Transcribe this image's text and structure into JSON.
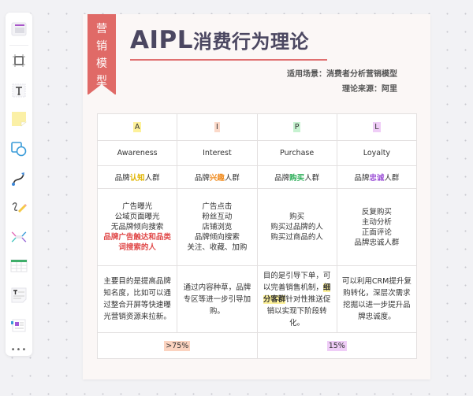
{
  "toolbar": {
    "items": [
      {
        "name": "frame-template-icon"
      },
      {
        "name": "crop-frame-icon"
      },
      {
        "name": "text-box-icon"
      },
      {
        "name": "sticky-note-icon"
      },
      {
        "name": "shapes-icon"
      },
      {
        "name": "connector-icon"
      },
      {
        "name": "pen-icon"
      },
      {
        "name": "mind-map-icon"
      },
      {
        "name": "table-icon"
      },
      {
        "name": "text-document-icon"
      },
      {
        "name": "template-cards-icon"
      },
      {
        "name": "more-icon"
      }
    ],
    "more_label": "•••"
  },
  "card": {
    "ribbon": [
      "营",
      "销",
      "模",
      "型"
    ],
    "title_en": "AIPL",
    "title_cn": "消费行为理论",
    "scenario": "适用场景：消费者分析营销模型",
    "source": "理论来源：阿里",
    "colors": {
      "ribbon": "#e06a67",
      "title": "#4b4761",
      "underline": "#e07070"
    }
  },
  "table": {
    "columns": [
      {
        "letter": "A",
        "letter_bg": "#fdf19a",
        "name": "Awareness",
        "group_pre": "品牌",
        "group_kw": "认知",
        "group_post": "人群",
        "kw_color": "#e0b400",
        "list": [
          "广告曝光",
          "公域页面曝光",
          "无品牌倾向搜索"
        ],
        "list_red": [
          "品牌广告触达和品类",
          "词搜索的人"
        ],
        "desc": "主要目的是提高品牌知名度，比如可以通过整合开屏等快速曝光营销资源来拉新。"
      },
      {
        "letter": "I",
        "letter_bg": "#fbd9c9",
        "name": "Interest",
        "group_pre": "品牌",
        "group_kw": "兴趣",
        "group_post": "人群",
        "kw_color": "#f08a1c",
        "list": [
          "广告点击",
          "粉丝互动",
          "店铺浏览",
          "品牌倾向搜索",
          "关注、收藏、加购"
        ],
        "list_red": [],
        "desc": "通过内容种草，品牌专区等进一步引导加购。"
      },
      {
        "letter": "P",
        "letter_bg": "#c6f2d0",
        "name": "Purchase",
        "group_pre": "品牌",
        "group_kw": "购买",
        "group_post": "人群",
        "kw_color": "#2fae5a",
        "list": [
          "购买",
          "购买过品牌的人",
          "购买过商品的人"
        ],
        "list_red": [],
        "desc_pre": "目的是引导下单，可以完善销售机制，",
        "desc_mark": "细分客群",
        "desc_post": "针对性推送促销以实现下阶段转化。"
      },
      {
        "letter": "L",
        "letter_bg": "#efcdf7",
        "name": "Loyalty",
        "group_pre": "品牌",
        "group_kw": "忠诚",
        "group_post": "人群",
        "kw_color": "#9b4fd6",
        "list": [
          "反复购买",
          "主动分析",
          "正面评论",
          "品牌忠诚人群"
        ],
        "list_red": [],
        "desc": "可以利用CRM提升复购转化，深层次需求挖掘以进一步提升品牌忠诚度。"
      }
    ],
    "footer": [
      {
        "value": ">75%",
        "bg": "#fbd3c0"
      },
      {
        "value": "15%",
        "bg": "#efcdf7"
      }
    ]
  }
}
